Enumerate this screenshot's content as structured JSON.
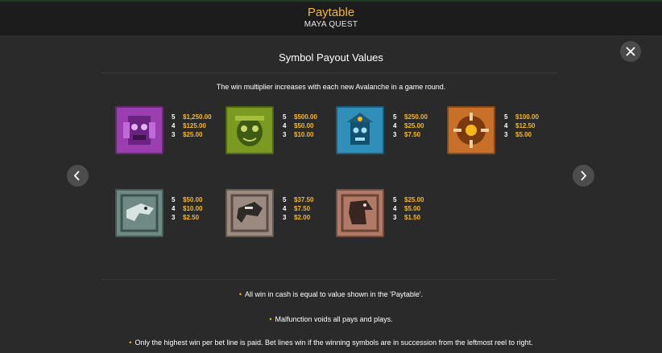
{
  "header": {
    "title": "Paytable",
    "subtitle": "MAYA QUEST"
  },
  "section": {
    "title": "Symbol Payout Values",
    "note": "The win multiplier increases with each new Avalanche in a game round."
  },
  "colors": {
    "accent": "#f5b81a",
    "background": "#2a2a2a",
    "header_bg": "#1c1c1c"
  },
  "symbols": [
    {
      "name": "purple-mask-symbol",
      "color": "#9b3fb0",
      "pays": [
        {
          "count": "5",
          "value": "$1,250.00"
        },
        {
          "count": "4",
          "value": "$125.00"
        },
        {
          "count": "3",
          "value": "$25.00"
        }
      ]
    },
    {
      "name": "green-mask-symbol",
      "color": "#7a9a22",
      "pays": [
        {
          "count": "5",
          "value": "$500.00"
        },
        {
          "count": "4",
          "value": "$50.00"
        },
        {
          "count": "3",
          "value": "$10.00"
        }
      ]
    },
    {
      "name": "blue-mask-symbol",
      "color": "#2f8fb8",
      "pays": [
        {
          "count": "5",
          "value": "$250.00"
        },
        {
          "count": "4",
          "value": "$25.00"
        },
        {
          "count": "3",
          "value": "$7.50"
        }
      ]
    },
    {
      "name": "orange-calendar-symbol",
      "color": "#c8702a",
      "pays": [
        {
          "count": "5",
          "value": "$100.00"
        },
        {
          "count": "4",
          "value": "$12.50"
        },
        {
          "count": "3",
          "value": "$5.00"
        }
      ]
    },
    {
      "name": "stone-serpent-symbol",
      "color": "#6f8a84",
      "pays": [
        {
          "count": "5",
          "value": "$50.00"
        },
        {
          "count": "4",
          "value": "$10.00"
        },
        {
          "count": "3",
          "value": "$2.50"
        }
      ]
    },
    {
      "name": "stone-jaguar-symbol",
      "color": "#9a8a80",
      "pays": [
        {
          "count": "5",
          "value": "$37.50"
        },
        {
          "count": "4",
          "value": "$7.50"
        },
        {
          "count": "3",
          "value": "$2.00"
        }
      ]
    },
    {
      "name": "stone-eagle-symbol",
      "color": "#b07a66",
      "pays": [
        {
          "count": "5",
          "value": "$25.00"
        },
        {
          "count": "4",
          "value": "$5.00"
        },
        {
          "count": "3",
          "value": "$1.50"
        }
      ]
    }
  ],
  "rules": [
    "All win in cash is equal to value shown in the 'Paytable'.",
    "Malfunction voids all pays and plays.",
    "Only the highest win per bet line is paid. Bet lines win if the winning symbols are in succession from the leftmost reel to right."
  ]
}
